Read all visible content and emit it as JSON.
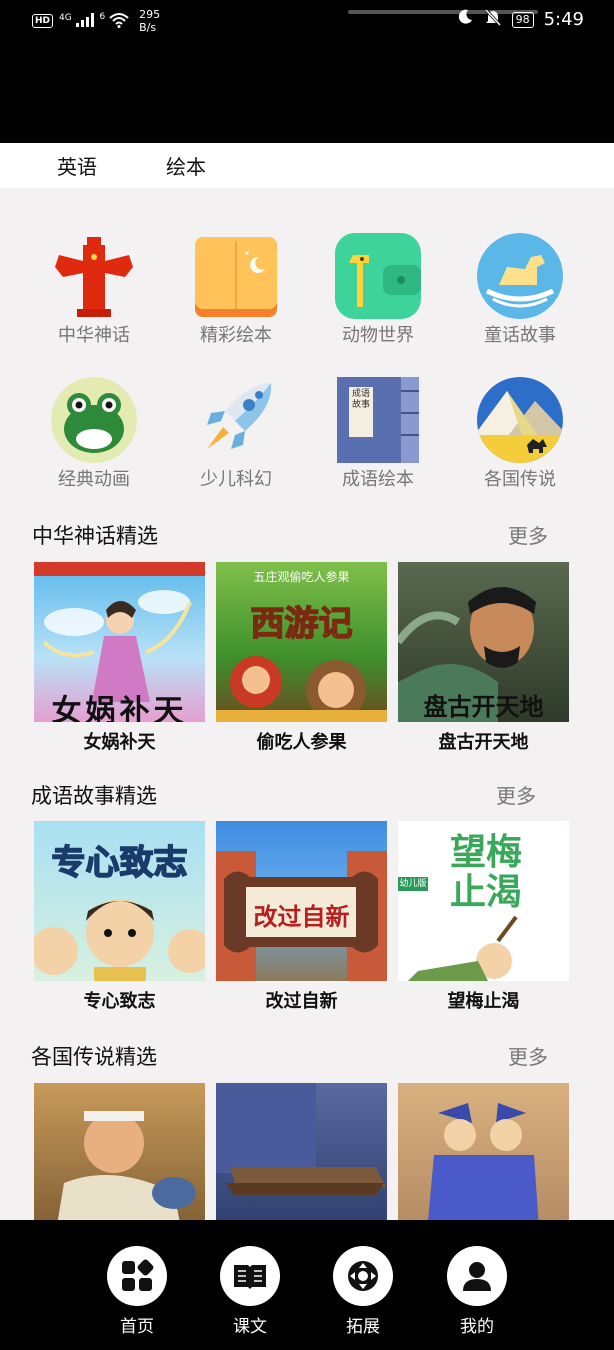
{
  "status": {
    "hd": "HD",
    "signal": "4G",
    "wifi": "6",
    "speed_value": "295",
    "speed_unit": "B/s",
    "battery": "98",
    "time": "5:49"
  },
  "tabs": [
    "英语",
    "绘本"
  ],
  "categories": [
    {
      "label": "中华神话",
      "icon": "pillar-icon"
    },
    {
      "label": "精彩绘本",
      "icon": "book-moon-icon"
    },
    {
      "label": "动物世界",
      "icon": "giraffe-icon"
    },
    {
      "label": "童话故事",
      "icon": "rocking-horse-icon"
    },
    {
      "label": "经典动画",
      "icon": "frog-icon"
    },
    {
      "label": "少儿科幻",
      "icon": "rocket-icon"
    },
    {
      "label": "成语绘本",
      "icon": "idiom-book-icon"
    },
    {
      "label": "各国传说",
      "icon": "pyramid-icon"
    }
  ],
  "idiom_book_text": "成语故事",
  "sections": [
    {
      "title": "中华神话精选",
      "more": "更多",
      "items": [
        {
          "title": "女娲补天",
          "thumb_text": "女娲补天",
          "bg": "#4aa8e0"
        },
        {
          "title": "偷吃人参果",
          "thumb_text": "西游记",
          "thumb_sub": "五庄观偷吃人参果",
          "bg": "#3f8f2c"
        },
        {
          "title": "盘古开天地",
          "thumb_text": "盘古开天地",
          "bg": "#3c4a36"
        }
      ]
    },
    {
      "title": "成语故事精选",
      "more": "更多",
      "items": [
        {
          "title": "专心致志",
          "thumb_text": "专心致志",
          "bg": "#9fd6e8"
        },
        {
          "title": "改过自新",
          "thumb_text": "改过自新",
          "bg": "#3f8be0"
        },
        {
          "title": "望梅止渴",
          "thumb_text": "望梅止渴",
          "thumb_sub": "幼儿版",
          "bg": "#ffffff"
        }
      ]
    },
    {
      "title": "各国传说精选",
      "more": "更多",
      "items": [
        {
          "title": "",
          "bg": "#c89a5a"
        },
        {
          "title": "",
          "bg": "#4a5a8a"
        },
        {
          "title": "",
          "bg": "#c8a070"
        }
      ]
    }
  ],
  "bottom_nav": [
    {
      "label": "首页",
      "icon": "home-grid-icon"
    },
    {
      "label": "课文",
      "icon": "open-book-icon"
    },
    {
      "label": "拓展",
      "icon": "ball-icon"
    },
    {
      "label": "我的",
      "icon": "user-icon"
    }
  ]
}
